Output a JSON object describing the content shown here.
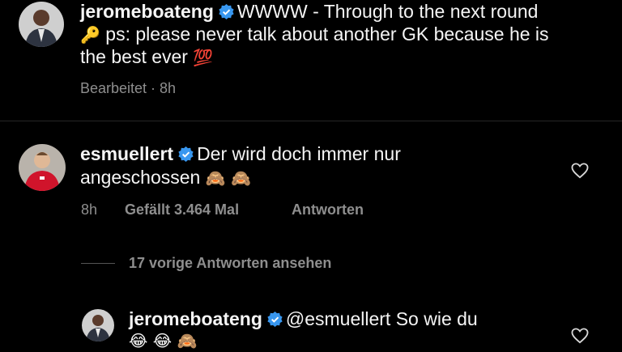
{
  "post": {
    "username": "jeromeboateng",
    "text_line1": "WWWW - Through to the next round",
    "text_line2": "ps: please never talk about another GK because he is",
    "text_line3": "the best ever",
    "key_emoji": "🔑",
    "hundred_emoji": "💯",
    "meta": "Bearbeitet · 8h"
  },
  "comment": {
    "username": "esmuellert",
    "text_line1": "Der wird doch immer nur",
    "text_line2": "angeschossen",
    "emojis": "🙈 🙈",
    "time": "8h",
    "likes": "Gefällt 3.464 Mal",
    "reply_label": "Antworten"
  },
  "view_replies_label": "17 vorige Antworten ansehen",
  "reply": {
    "username": "jeromeboateng",
    "text": "@esmuellert So wie du",
    "emojis": "😂 😂 🙈"
  },
  "colors": {
    "background": "#000000",
    "text": "#f5f5f5",
    "secondary": "#8e8e8e",
    "verified": "#3897f0"
  }
}
